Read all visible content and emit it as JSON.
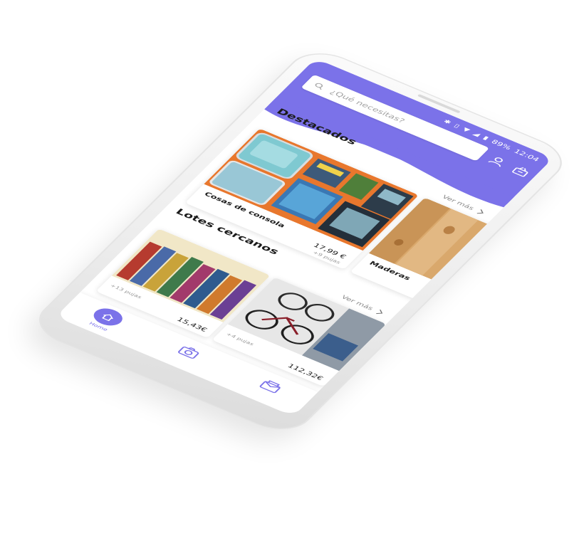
{
  "status_bar": {
    "battery": "89%",
    "time": "12:04"
  },
  "search": {
    "placeholder": "¿Qué necesitas?"
  },
  "featured": {
    "title": "Destacados",
    "see_more": "Ver más",
    "cards": [
      {
        "title": "Cosas de consola",
        "price": "17,99 €",
        "bids": "+9 pujas"
      },
      {
        "title": "Maderas"
      }
    ]
  },
  "nearby": {
    "title": "Lotes cercanos",
    "see_more": "Ver más",
    "lots": [
      {
        "bids": "+13 pujas",
        "price": "15,43€"
      },
      {
        "bids": "+4 pujas",
        "price": "112,32€"
      }
    ]
  },
  "bottom_nav": {
    "home_label": "Home"
  },
  "colors": {
    "accent": "#7b72e9",
    "orange": "#e8772d",
    "wood": "#d9a86c"
  }
}
